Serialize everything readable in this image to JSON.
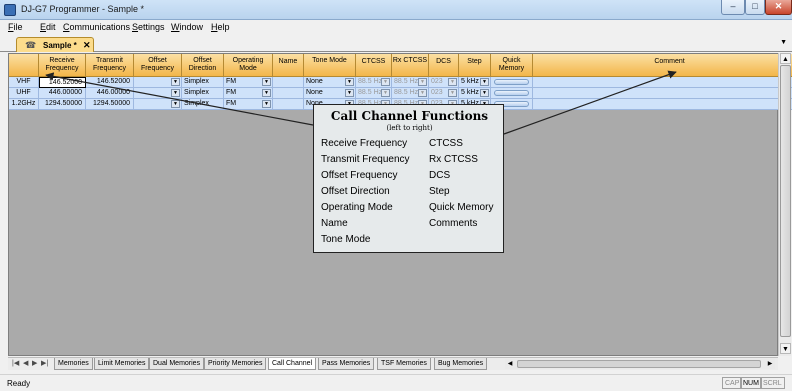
{
  "window": {
    "title": "DJ-G7 Programmer - Sample *",
    "minimize": "–",
    "maximize": "□",
    "close": "✕"
  },
  "menu": [
    {
      "u": "F",
      "rest": "ile"
    },
    {
      "u": "E",
      "rest": "dit"
    },
    {
      "u": "C",
      "rest": "ommunications"
    },
    {
      "u": "S",
      "rest": "ettings"
    },
    {
      "u": "W",
      "rest": "indow"
    },
    {
      "u": "H",
      "rest": "elp"
    }
  ],
  "document_tab": {
    "label": "Sample *",
    "close": "✕",
    "icon": "radio-icon"
  },
  "grid": {
    "columns": [
      "Receive Frequency",
      "Transmit Frequency",
      "Offset Frequency",
      "Offset Direction",
      "Operating Mode",
      "Name",
      "Tone Mode",
      "CTCSS",
      "Rx CTCSS",
      "DCS",
      "Step",
      "Quick Memory",
      "Comment"
    ],
    "rows": [
      {
        "band": "VHF",
        "rx": "146.52000",
        "tx": "146.52000",
        "offset": "",
        "direction": "Simplex",
        "mode": "FM",
        "name": "",
        "tone": "None",
        "ctcss": "88.5 Hz",
        "rxctcss": "88.5 Hz",
        "dcs": "023",
        "step": "5 kHz",
        "comment": ""
      },
      {
        "band": "UHF",
        "rx": "446.00000",
        "tx": "446.00000",
        "offset": "",
        "direction": "Simplex",
        "mode": "FM",
        "name": "",
        "tone": "None",
        "ctcss": "88.5 Hz",
        "rxctcss": "88.5 Hz",
        "dcs": "023",
        "step": "5 kHz",
        "comment": ""
      },
      {
        "band": "1.2GHz",
        "rx": "1294.50000",
        "tx": "1294.50000",
        "offset": "",
        "direction": "Simplex",
        "mode": "FM",
        "name": "",
        "tone": "None",
        "ctcss": "88.5 Hz",
        "rxctcss": "88.5 Hz",
        "dcs": "023",
        "step": "5 kHz",
        "comment": ""
      }
    ]
  },
  "sheet_tabs": [
    "Memories",
    "Limit Memories",
    "Dual Memories",
    "Priority Memories",
    "Call Channel",
    "Pass Memories",
    "TSF Memories",
    "Bug Memories"
  ],
  "active_sheet": "Call Channel",
  "callout": {
    "title": "Call Channel Functions",
    "subtitle": "(left to right)",
    "left": [
      "Receive Frequency",
      "Transmit Frequency",
      "Offset Frequency",
      "Offset Direction",
      "Operating Mode",
      "Name",
      "Tone Mode"
    ],
    "right": [
      "CTCSS",
      "Rx CTCSS",
      "DCS",
      "Step",
      "Quick Memory",
      "Comments"
    ]
  },
  "status": {
    "text": "Ready",
    "indicators": [
      "CAP",
      "NUM",
      "SCRL"
    ]
  },
  "colors": {
    "header": "#f3b64a",
    "row": "#cfe2fa",
    "title_bar": "#b9d3ee",
    "active_tab": "#fcdc8c"
  }
}
